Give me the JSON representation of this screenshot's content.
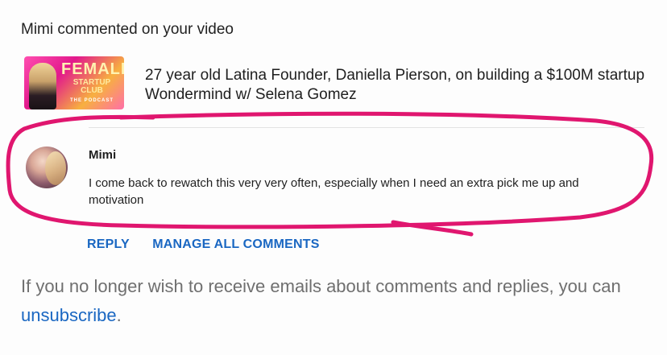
{
  "notification": {
    "header": "Mimi commented on your video"
  },
  "video": {
    "title": "27 year old Latina Founder, Daniella Pierson, on building a $100M startup Wondermind w/ Selena Gomez",
    "thumbnail": {
      "brand_line1": "FEMALE",
      "brand_line2": "STARTUP CLUB",
      "brand_line3": "THE PODCAST"
    }
  },
  "comment": {
    "author": "Mimi",
    "text": "I come back to rewatch this very very often, especially when I need an extra pick me up and motivation"
  },
  "actions": {
    "reply_label": "REPLY",
    "manage_label": "MANAGE ALL COMMENTS"
  },
  "footer": {
    "text_before": "If you no longer wish to receive emails about comments and replies, you can ",
    "link_label": "unsubscribe",
    "text_after": "."
  },
  "colors": {
    "link_blue": "#1a67c2",
    "highlight_pink": "#e0166f"
  }
}
